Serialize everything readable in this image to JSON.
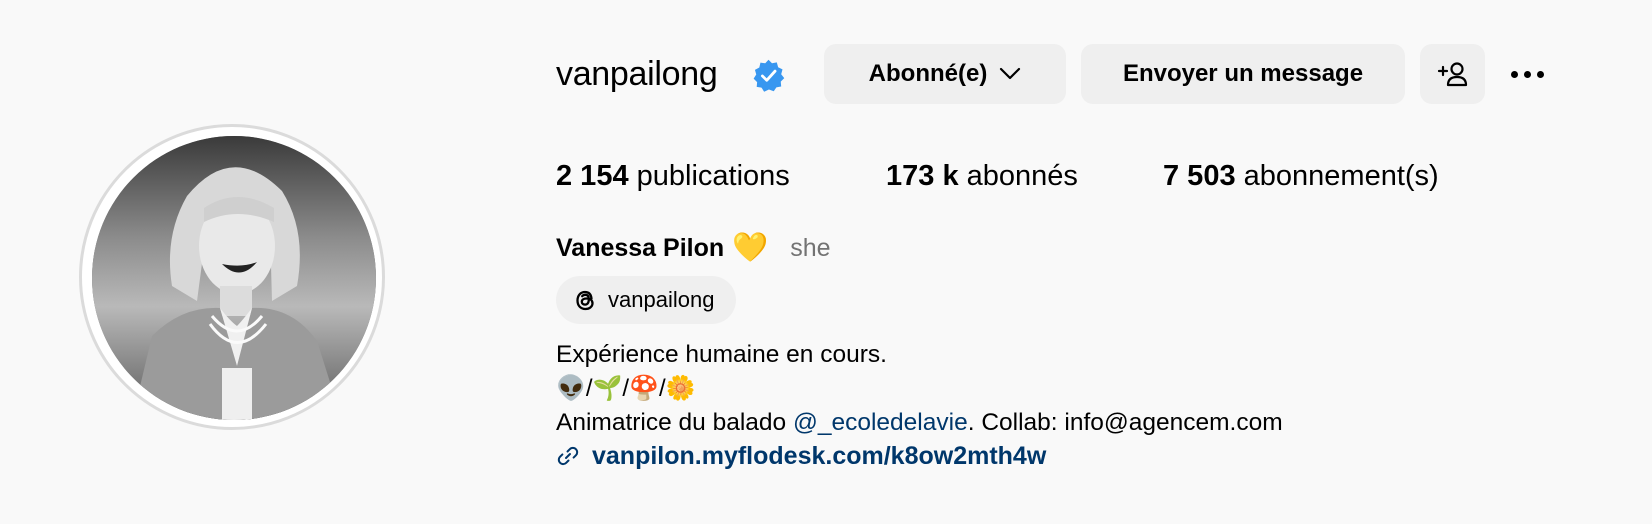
{
  "profile": {
    "username": "vanpailong",
    "verified_icon": "verified-badge-icon",
    "avatar_description": "black-and-white-portrait"
  },
  "actions": {
    "follow_label": "Abonné(e)",
    "message_label": "Envoyer un message",
    "suggest_icon": "add-person-icon",
    "more_icon": "more-options-icon"
  },
  "stats": {
    "posts_count": "2 154",
    "posts_label": "publications",
    "followers_count": "173 k",
    "followers_label": "abonnés",
    "following_count": "7 503",
    "following_label": "abonnement(s)"
  },
  "bio": {
    "full_name": "Vanessa Pilon",
    "name_emoji": "💛",
    "pronouns": "she",
    "threads_handle": "vanpailong",
    "line1": "Expérience humaine en cours.",
    "line2": "👽/🌱/🍄/🌼",
    "line3_prefix": "Animatrice du balado ",
    "line3_mention": "@_ecoledelavie",
    "line3_suffix": ". Collab: info@agencem.com",
    "link": "vanpilon.myflodesk.com/k8ow2mth4w"
  },
  "colors": {
    "background": "#f9f9f9",
    "button_bg": "#efefef",
    "verified_blue": "#0095f6",
    "link_blue": "#00376b",
    "secondary_text": "#737373"
  }
}
